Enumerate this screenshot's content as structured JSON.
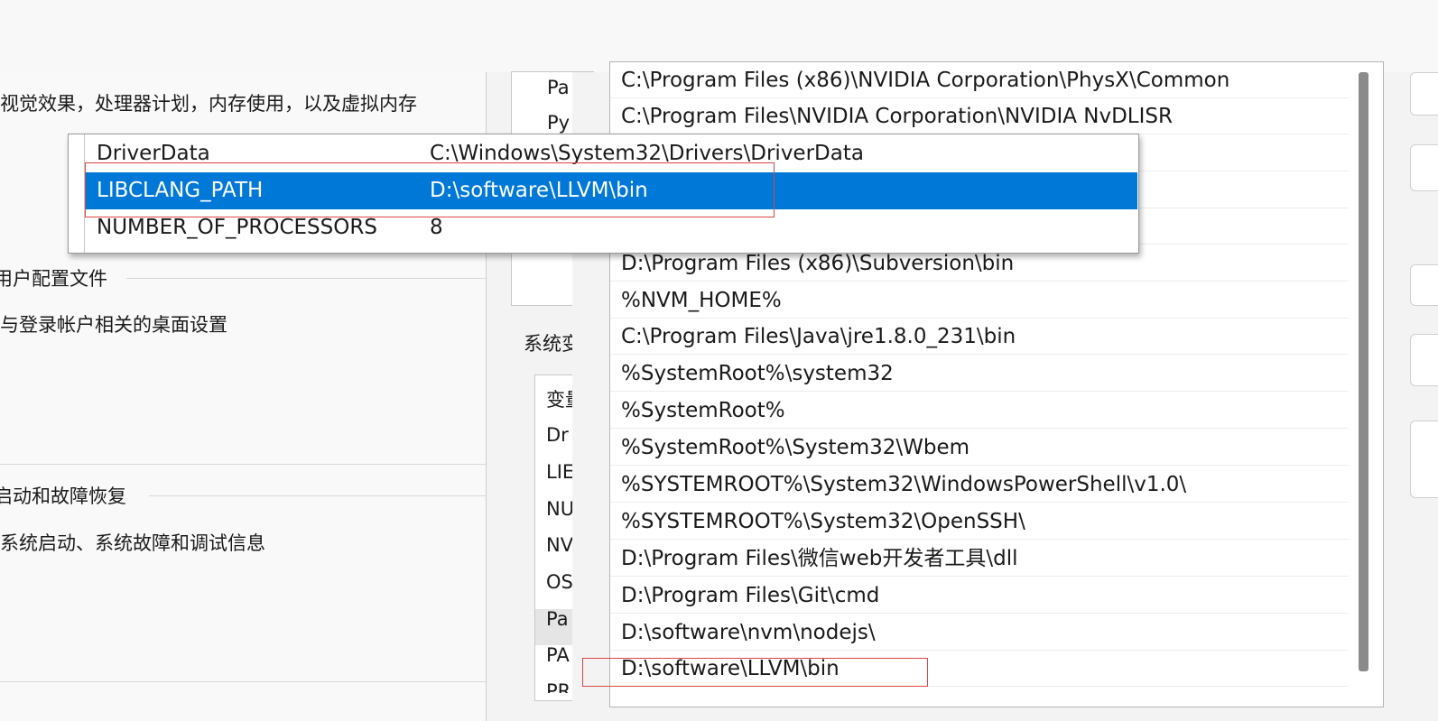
{
  "left_panel": {
    "performance_desc": "视觉效果，处理器计划，内存使用，以及虚拟内存",
    "user_profiles_title": "用户配置文件",
    "user_profiles_desc": "与登录帐户相关的桌面设置",
    "startup_title": "启动和故障恢复",
    "startup_desc": "系统启动、系统故障和调试信息"
  },
  "mid_panel": {
    "user_var_rows": [
      "Pa",
      "Py"
    ],
    "system_vars_label": "系统变量",
    "table_header": "变量",
    "system_var_rows": [
      "Dr",
      "LIE",
      "NU",
      "NV",
      "OS",
      "Pa",
      "PA",
      "PR"
    ]
  },
  "path_entries": [
    "C:\\Program Files (x86)\\NVIDIA Corporation\\PhysX\\Common",
    "C:\\Program Files\\NVIDIA Corporation\\NVIDIA NvDLISR",
    "",
    "",
    "",
    "D:\\Program Files (x86)\\Subversion\\bin",
    "%NVM_HOME%",
    "C:\\Program Files\\Java\\jre1.8.0_231\\bin",
    "%SystemRoot%\\system32",
    "%SystemRoot%",
    "%SystemRoot%\\System32\\Wbem",
    "%SYSTEMROOT%\\System32\\WindowsPowerShell\\v1.0\\",
    "%SYSTEMROOT%\\System32\\OpenSSH\\",
    "D:\\Program Files\\微信web开发者工具\\dll",
    "D:\\Program Files\\Git\\cmd",
    "D:\\software\\nvm\\nodejs\\",
    "D:\\software\\LLVM\\bin"
  ],
  "popup": {
    "rows": [
      {
        "name": "DriverData",
        "value": "C:\\Windows\\System32\\Drivers\\DriverData",
        "selected": false
      },
      {
        "name": "LIBCLANG_PATH",
        "value": "D:\\software\\LLVM\\bin",
        "selected": true
      },
      {
        "name": "NUMBER_OF_PROCESSORS",
        "value": "8",
        "selected": false
      }
    ]
  },
  "colors": {
    "selection": "#0078d7",
    "highlight_box": "#e04545"
  }
}
